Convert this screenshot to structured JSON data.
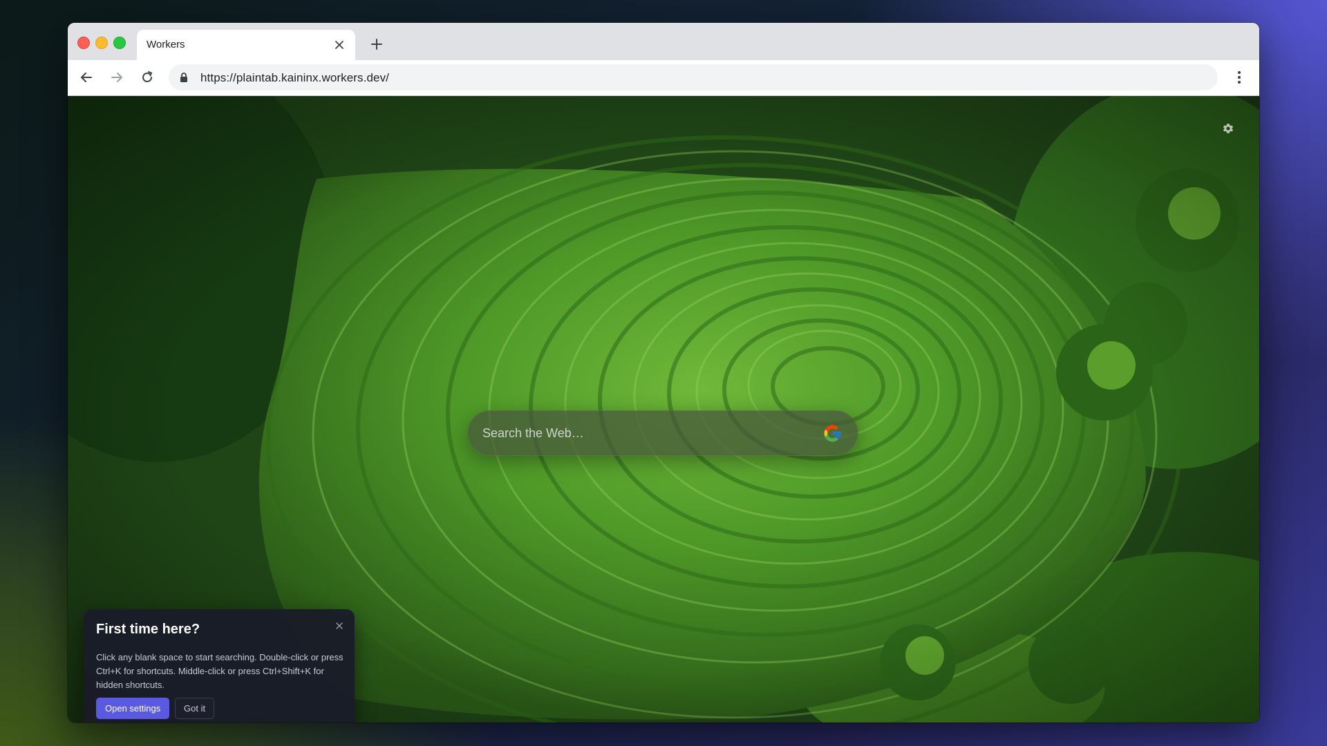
{
  "browser": {
    "tab": {
      "title": "Workers",
      "close_icon": "close-icon"
    },
    "new_tab_icon": "plus-icon",
    "nav": {
      "back_icon": "arrow-left-icon",
      "forward_icon": "arrow-right-icon",
      "reload_icon": "reload-icon",
      "menu_icon": "kebab-menu-icon"
    },
    "address_bar": {
      "lock_icon": "lock-icon",
      "url": "https://plaintab.kaininx.workers.dev/"
    }
  },
  "page": {
    "settings_icon": "gear-icon",
    "search": {
      "placeholder": "Search the Web…",
      "engine_icon": "google-icon"
    },
    "onboarding": {
      "title": "First time here?",
      "body": "Click any blank space to start searching. Double-click or press Ctrl+K for shortcuts. Middle-click or press Ctrl+Shift+K for hidden shortcuts.",
      "primary_label": "Open settings",
      "secondary_label": "Got it",
      "close_icon": "close-icon"
    }
  },
  "colors": {
    "accent": "#5a5ae0",
    "tabstrip": "#dfe1e5",
    "popup_bg": "#1a1c28"
  }
}
